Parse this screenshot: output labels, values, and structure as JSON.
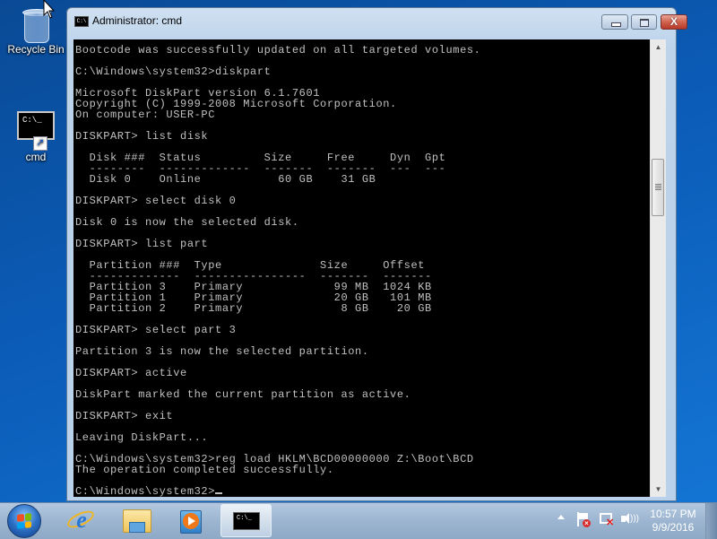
{
  "desktop": {
    "icons": [
      {
        "label": "Recycle Bin",
        "icon": "recycle-bin-icon"
      },
      {
        "label": "cmd",
        "icon": "cmd-shortcut-icon"
      }
    ]
  },
  "window": {
    "title": "Administrator: cmd",
    "icon": "cmd-icon",
    "controls": {
      "minimize": "minimize",
      "maximize": "maximize",
      "close": "close"
    },
    "close_glyph": "X",
    "console_lines": [
      "Bootcode was successfully updated on all targeted volumes.",
      "",
      "C:\\Windows\\system32>diskpart",
      "",
      "Microsoft DiskPart version 6.1.7601",
      "Copyright (C) 1999-2008 Microsoft Corporation.",
      "On computer: USER-PC",
      "",
      "DISKPART> list disk",
      "",
      "  Disk ###  Status         Size     Free     Dyn  Gpt",
      "  --------  -------------  -------  -------  ---  ---",
      "  Disk 0    Online           60 GB    31 GB",
      "",
      "DISKPART> select disk 0",
      "",
      "Disk 0 is now the selected disk.",
      "",
      "DISKPART> list part",
      "",
      "  Partition ###  Type              Size     Offset",
      "  -------------  ----------------  -------  -------",
      "  Partition 3    Primary             99 MB  1024 KB",
      "  Partition 1    Primary             20 GB   101 MB",
      "  Partition 2    Primary              8 GB    20 GB",
      "",
      "DISKPART> select part 3",
      "",
      "Partition 3 is now the selected partition.",
      "",
      "DISKPART> active",
      "",
      "DiskPart marked the current partition as active.",
      "",
      "DISKPART> exit",
      "",
      "Leaving DiskPart...",
      "",
      "C:\\Windows\\system32>reg load HKLM\\BCD00000000 Z:\\Boot\\BCD",
      "The operation completed successfully.",
      ""
    ],
    "prompt": "C:\\Windows\\system32>",
    "colors": {
      "console_bg": "#000000",
      "console_fg": "#c0c0c0"
    }
  },
  "taskbar": {
    "items": [
      {
        "name": "start",
        "icon": "windows-logo-icon"
      },
      {
        "name": "internet-explorer",
        "icon": "internet-explorer-icon",
        "glyph": "e"
      },
      {
        "name": "windows-explorer",
        "icon": "folder-icon"
      },
      {
        "name": "windows-media-player",
        "icon": "media-player-icon"
      },
      {
        "name": "cmd",
        "icon": "cmd-icon",
        "glyph": "C:\\_",
        "active": true
      }
    ],
    "tray": {
      "icons": [
        "show-hidden-icons",
        "action-center-error-icon",
        "network-disconnected-icon",
        "volume-icon"
      ],
      "time": "10:57 PM",
      "date": "9/9/2016"
    }
  },
  "desktop_icon_text": {
    "cmd_glyph": "C:\\_"
  }
}
